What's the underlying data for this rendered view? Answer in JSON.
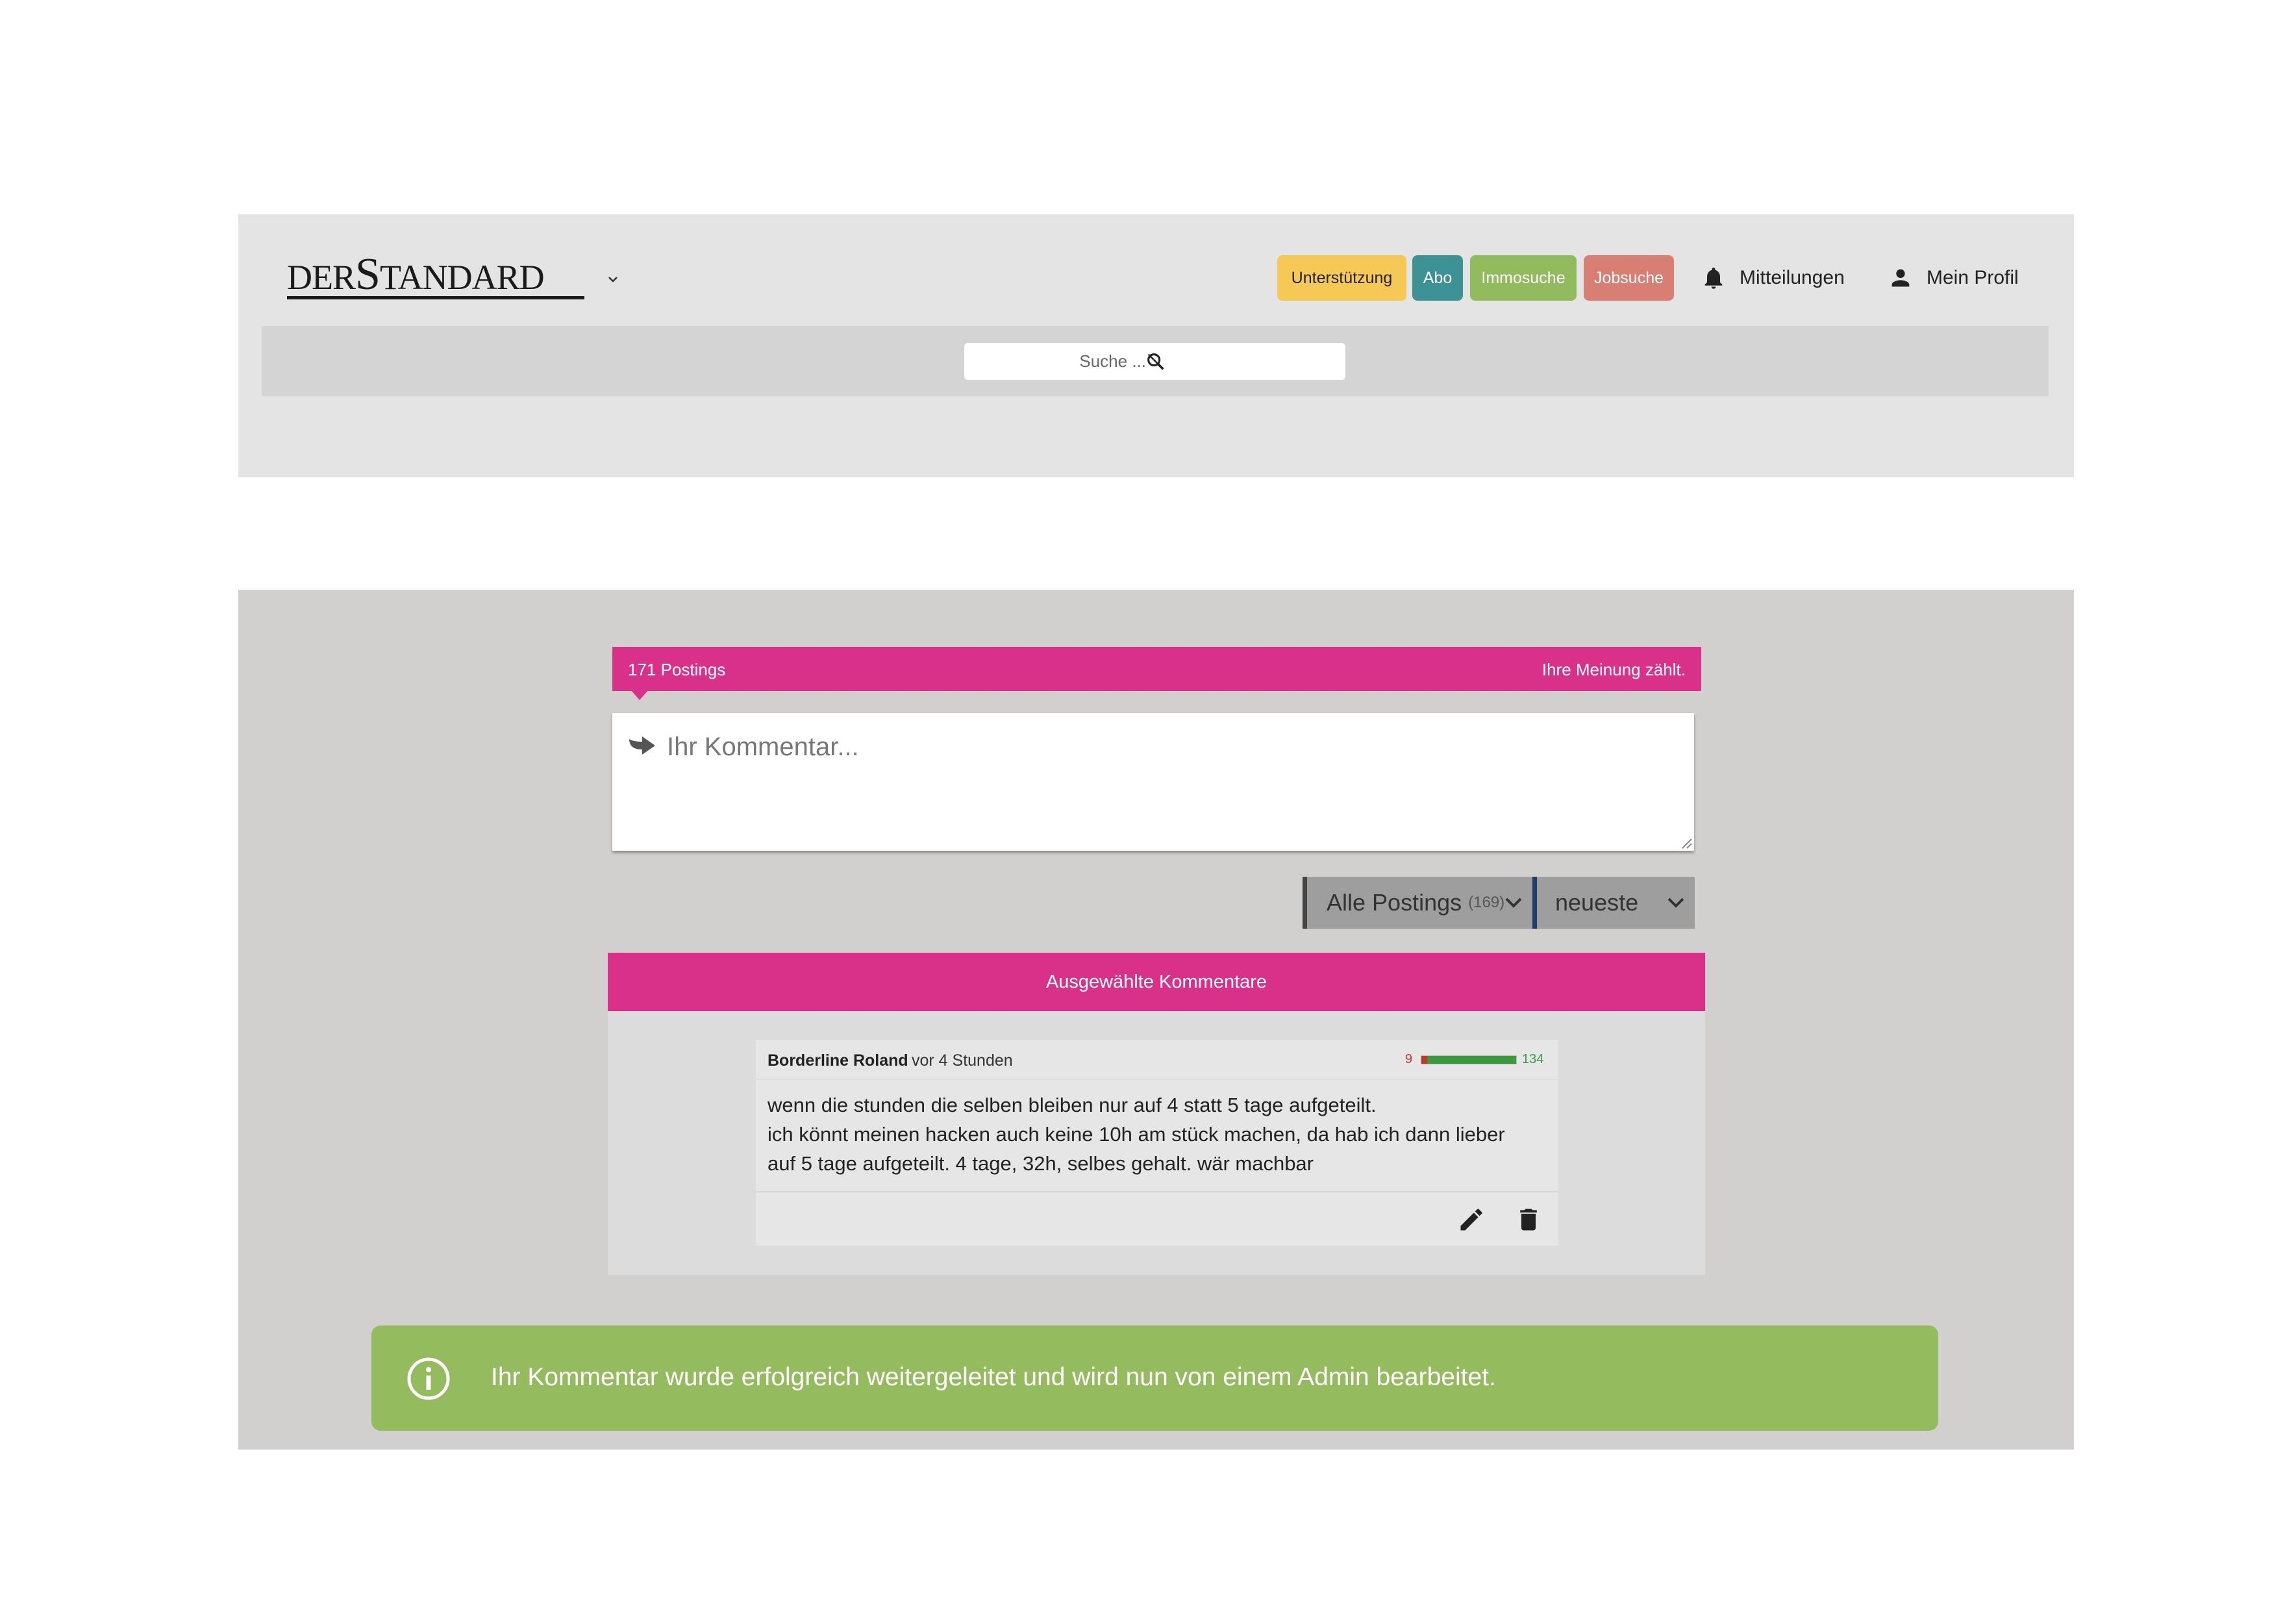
{
  "header": {
    "logo_der": "DER",
    "logo_s": "S",
    "logo_rest": "TANDARD",
    "nav_buttons": {
      "support": "Unterstützung",
      "abo": "Abo",
      "immo": "Immosuche",
      "jobs": "Jobsuche"
    },
    "notifications": "Mitteilungen",
    "profile": "Mein Profil",
    "search_placeholder": "Suche ..."
  },
  "forum": {
    "postings_count": "171 Postings",
    "tagline": "Ihre Meinung zählt.",
    "comment_placeholder": "Ihr Kommentar...",
    "filter_label": "Alle Postings",
    "filter_count": "(169)",
    "sort_label": "neueste",
    "featured_title": "Ausgewählte Kommentare"
  },
  "post": {
    "author": "Borderline Roland",
    "time": "vor 4 Stunden",
    "rating_negative": 9,
    "rating_positive": 134,
    "lines": [
      "wenn die stunden die selben bleiben nur auf 4 statt 5 tage aufgeteilt.",
      "ich könnt meinen hacken auch keine 10h am stück machen, da hab ich dann lieber",
      "auf 5 tage aufgeteilt. 4 tage, 32h, selbes gehalt. wär machbar"
    ]
  },
  "toast": {
    "message": "Ihr Kommentar wurde erfolgreich weitergeleitet und wird nun von einem Admin bearbeitet."
  },
  "colors": {
    "accent_pink": "#d9318a",
    "success_green": "#94bb5e",
    "support_yellow": "#f6c957",
    "abo_teal": "#3d9296",
    "immo_green": "#92bb5d",
    "jobs_red": "#d87e73"
  }
}
